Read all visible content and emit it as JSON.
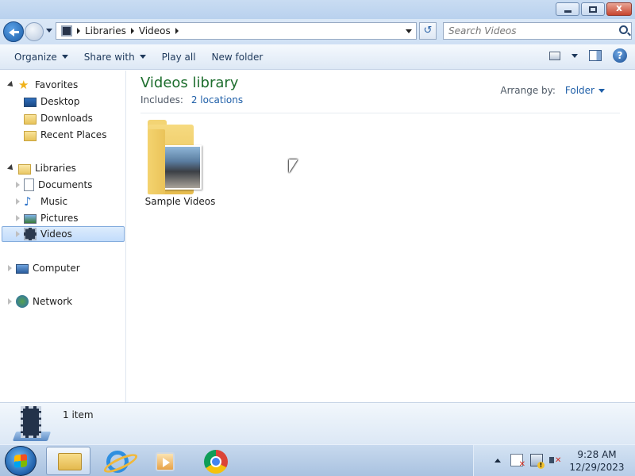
{
  "window": {
    "close_glyph": "x"
  },
  "address_bar": {
    "crumbs": [
      "Libraries",
      "Videos"
    ],
    "refresh_glyph": "↺"
  },
  "search": {
    "placeholder": "Search Videos"
  },
  "command_bar": {
    "organize": "Organize",
    "share_with": "Share with",
    "play_all": "Play all",
    "new_folder": "New folder",
    "help_glyph": "?"
  },
  "nav_pane": {
    "favorites": "Favorites",
    "desktop": "Desktop",
    "downloads": "Downloads",
    "recent_places": "Recent Places",
    "libraries": "Libraries",
    "documents": "Documents",
    "music": "Music",
    "pictures": "Pictures",
    "videos": "Videos",
    "computer": "Computer",
    "network": "Network",
    "star_glyph": "★",
    "note_glyph": "♪"
  },
  "content": {
    "title": "Videos library",
    "includes_label": "Includes:",
    "includes_link": "2 locations",
    "arrange_label": "Arrange by:",
    "arrange_value": "Folder",
    "items": [
      {
        "label": "Sample Videos"
      }
    ]
  },
  "details_pane": {
    "item_count": "1 item"
  },
  "taskbar": {
    "time": "9:28 AM",
    "date": "12/29/2023"
  },
  "colors": {
    "title_green": "#1e6e2e",
    "link_blue": "#1f5fa8",
    "selection": "#c2dcfb"
  }
}
